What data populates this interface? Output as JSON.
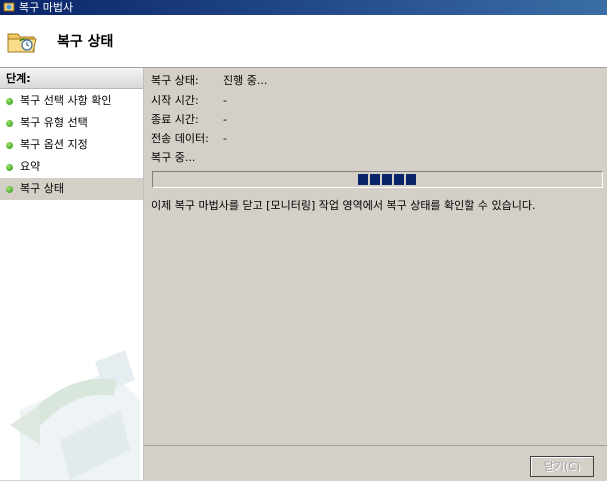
{
  "window": {
    "title": "복구 마법사"
  },
  "header": {
    "title": "복구 상태"
  },
  "sidebar": {
    "title": "단계:",
    "steps": [
      {
        "label": "복구 선택 사항 확인"
      },
      {
        "label": "복구 유형 선택"
      },
      {
        "label": "복구 옵션 지정"
      },
      {
        "label": "요약"
      },
      {
        "label": "복구 상태",
        "active": true
      }
    ]
  },
  "status": {
    "rows": [
      {
        "label": "복구 상태:",
        "value": "진행 중..."
      },
      {
        "label": "시작 시간:",
        "value": "-"
      },
      {
        "label": "종료 시간:",
        "value": "-"
      },
      {
        "label": "전송 데이터:",
        "value": "-"
      }
    ],
    "activity": "복구 중...",
    "note": "이제 복구 마법사를 닫고 [모니터링] 작업 영역에서 복구 상태를 확인할 수 있습니다."
  },
  "progress": {
    "state": "indeterminate",
    "block_color": "#0a246a"
  },
  "footer": {
    "close_label": "닫기(C)",
    "close_enabled": false
  },
  "icons": {
    "title_icon": "backup-app-icon",
    "header_icon": "folder-recovery-icon",
    "step_icon": "green-bullet-icon"
  }
}
